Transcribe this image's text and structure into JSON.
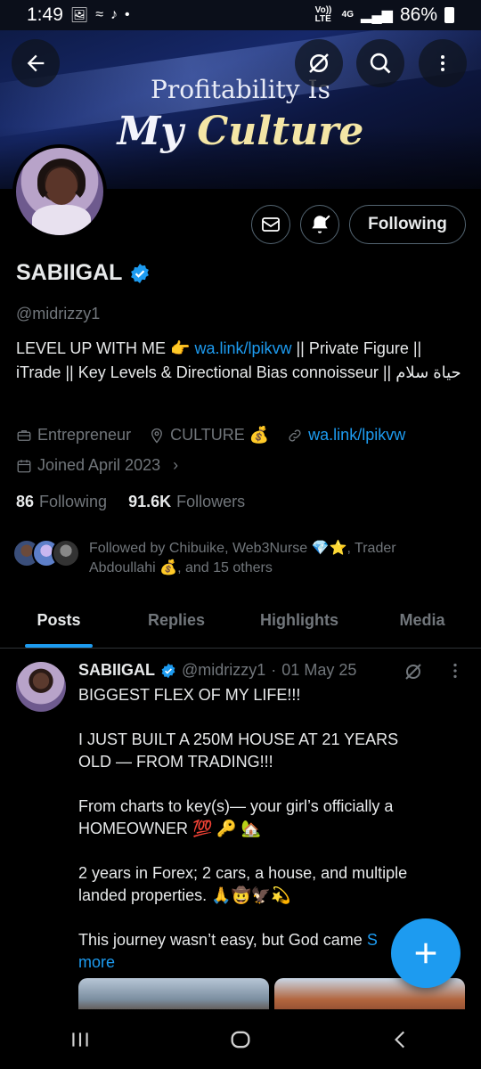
{
  "status_bar": {
    "time": "1:49",
    "left_icons": [
      "image-icon",
      "signal-dots-icon",
      "tiktok-icon",
      "dot-icon"
    ],
    "volte_label": "Vo)) LTE",
    "network_label": "4G",
    "battery": "86%"
  },
  "banner": {
    "line1": "Profitability Is",
    "line2_a": "My",
    "line2_b": "Culture"
  },
  "profile": {
    "name": "SABIIGAL",
    "handle": "@midrizzy1",
    "bio_1": "LEVEL UP WITH ME 👉 ",
    "bio_link": "wa.link/lpikvw",
    "bio_2": " || Private Figure || iTrade || Key Levels & Directional Bias connoisseur || حياة سلام",
    "category": "Entrepreneur",
    "location": "CULTURE 💰",
    "website": "wa.link/lpikvw",
    "joined": "Joined April 2023",
    "following_count": "86",
    "following_label": "Following",
    "followers_count": "91.6K",
    "followers_label": "Followers",
    "followed_by": "Followed by Chibuike, Web3Nurse 💎⭐, Trader Abdoullahi 💰, and 15 others",
    "follow_button": "Following"
  },
  "tabs": [
    "Posts",
    "Replies",
    "Highlights",
    "Media"
  ],
  "post": {
    "author": "SABIIGAL",
    "handle": "@midrizzy1",
    "separator": "·",
    "date": "01 May 25",
    "text": "BIGGEST FLEX OF MY LIFE!!!\n\nI JUST BUILT A 250M HOUSE AT 21 YEARS OLD — FROM TRADING!!!\n\nFrom charts to key(s)— your girl’s officially a HOMEOWNER 💯 🔑 🏡\n\n2 years in Forex; 2 cars, a house, and multiple landed properties. 🙏🤠🦅💫\n\nThis journey wasn’t easy, but God came ",
    "show_more_1": "S",
    "show_more_2": "more"
  },
  "colors": {
    "accent": "#1d9bf0",
    "background": "#000000",
    "text": "#e7e9ea",
    "muted": "#71767b"
  }
}
